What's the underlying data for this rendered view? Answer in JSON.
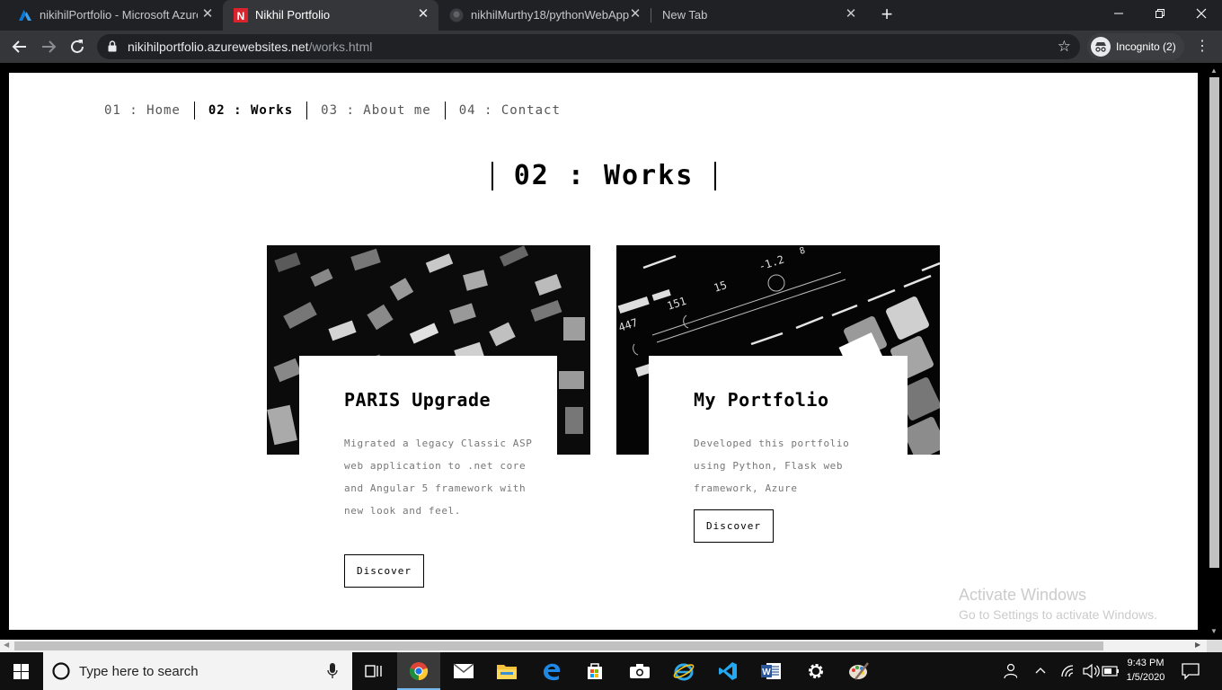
{
  "browser": {
    "tabs": [
      {
        "title": "nikihilPortfolio - Microsoft Azure",
        "icon": "azure-icon",
        "active": false
      },
      {
        "title": "Nikhil Portfolio",
        "icon": "n-logo-icon",
        "active": true
      },
      {
        "title": "nikhilMurthy18/pythonWebApp",
        "icon": "github-icon",
        "active": false
      },
      {
        "title": "New Tab",
        "icon": "",
        "active": false
      }
    ],
    "new_tab_label": "+",
    "url_host": "nikihilportfolio.azurewebsites.net",
    "url_path": "/works.html",
    "incognito_label": "Incognito (2)"
  },
  "site": {
    "nav": [
      {
        "label": "01 : Home"
      },
      {
        "label": "02 : Works"
      },
      {
        "label": "03 : About me"
      },
      {
        "label": "04 : Contact"
      }
    ],
    "heading": "02 : Works",
    "cards": [
      {
        "image": "typography-letterpress-image",
        "title": "PARIS Upgrade",
        "description": "Migrated a legacy Classic ASP web application to .net core and Angular 5 framework with new look and feel.",
        "button": "Discover"
      },
      {
        "image": "synth-controller-image",
        "title": "My Portfolio",
        "description": "Developed this portfolio using Python, Flask web framework, Azure",
        "button": "Discover"
      }
    ]
  },
  "watermark": {
    "line1": "Activate Windows",
    "line2": "Go to Settings to activate Windows."
  },
  "taskbar": {
    "search_placeholder": "Type here to search",
    "time": "9:43 PM",
    "date": "1/5/2020",
    "pinned": [
      "task-view-icon",
      "chrome-icon",
      "mail-icon",
      "file-explorer-icon",
      "edge-icon",
      "store-icon",
      "camera-icon",
      "internet-explorer-icon",
      "vscode-icon",
      "word-icon",
      "settings-icon",
      "paint-icon"
    ]
  },
  "colors": {
    "tabstrip": "#202124",
    "toolbar": "#35363a",
    "taskbar": "#101010",
    "page": "#ffffff",
    "accent_underline": "#76b9ed"
  }
}
